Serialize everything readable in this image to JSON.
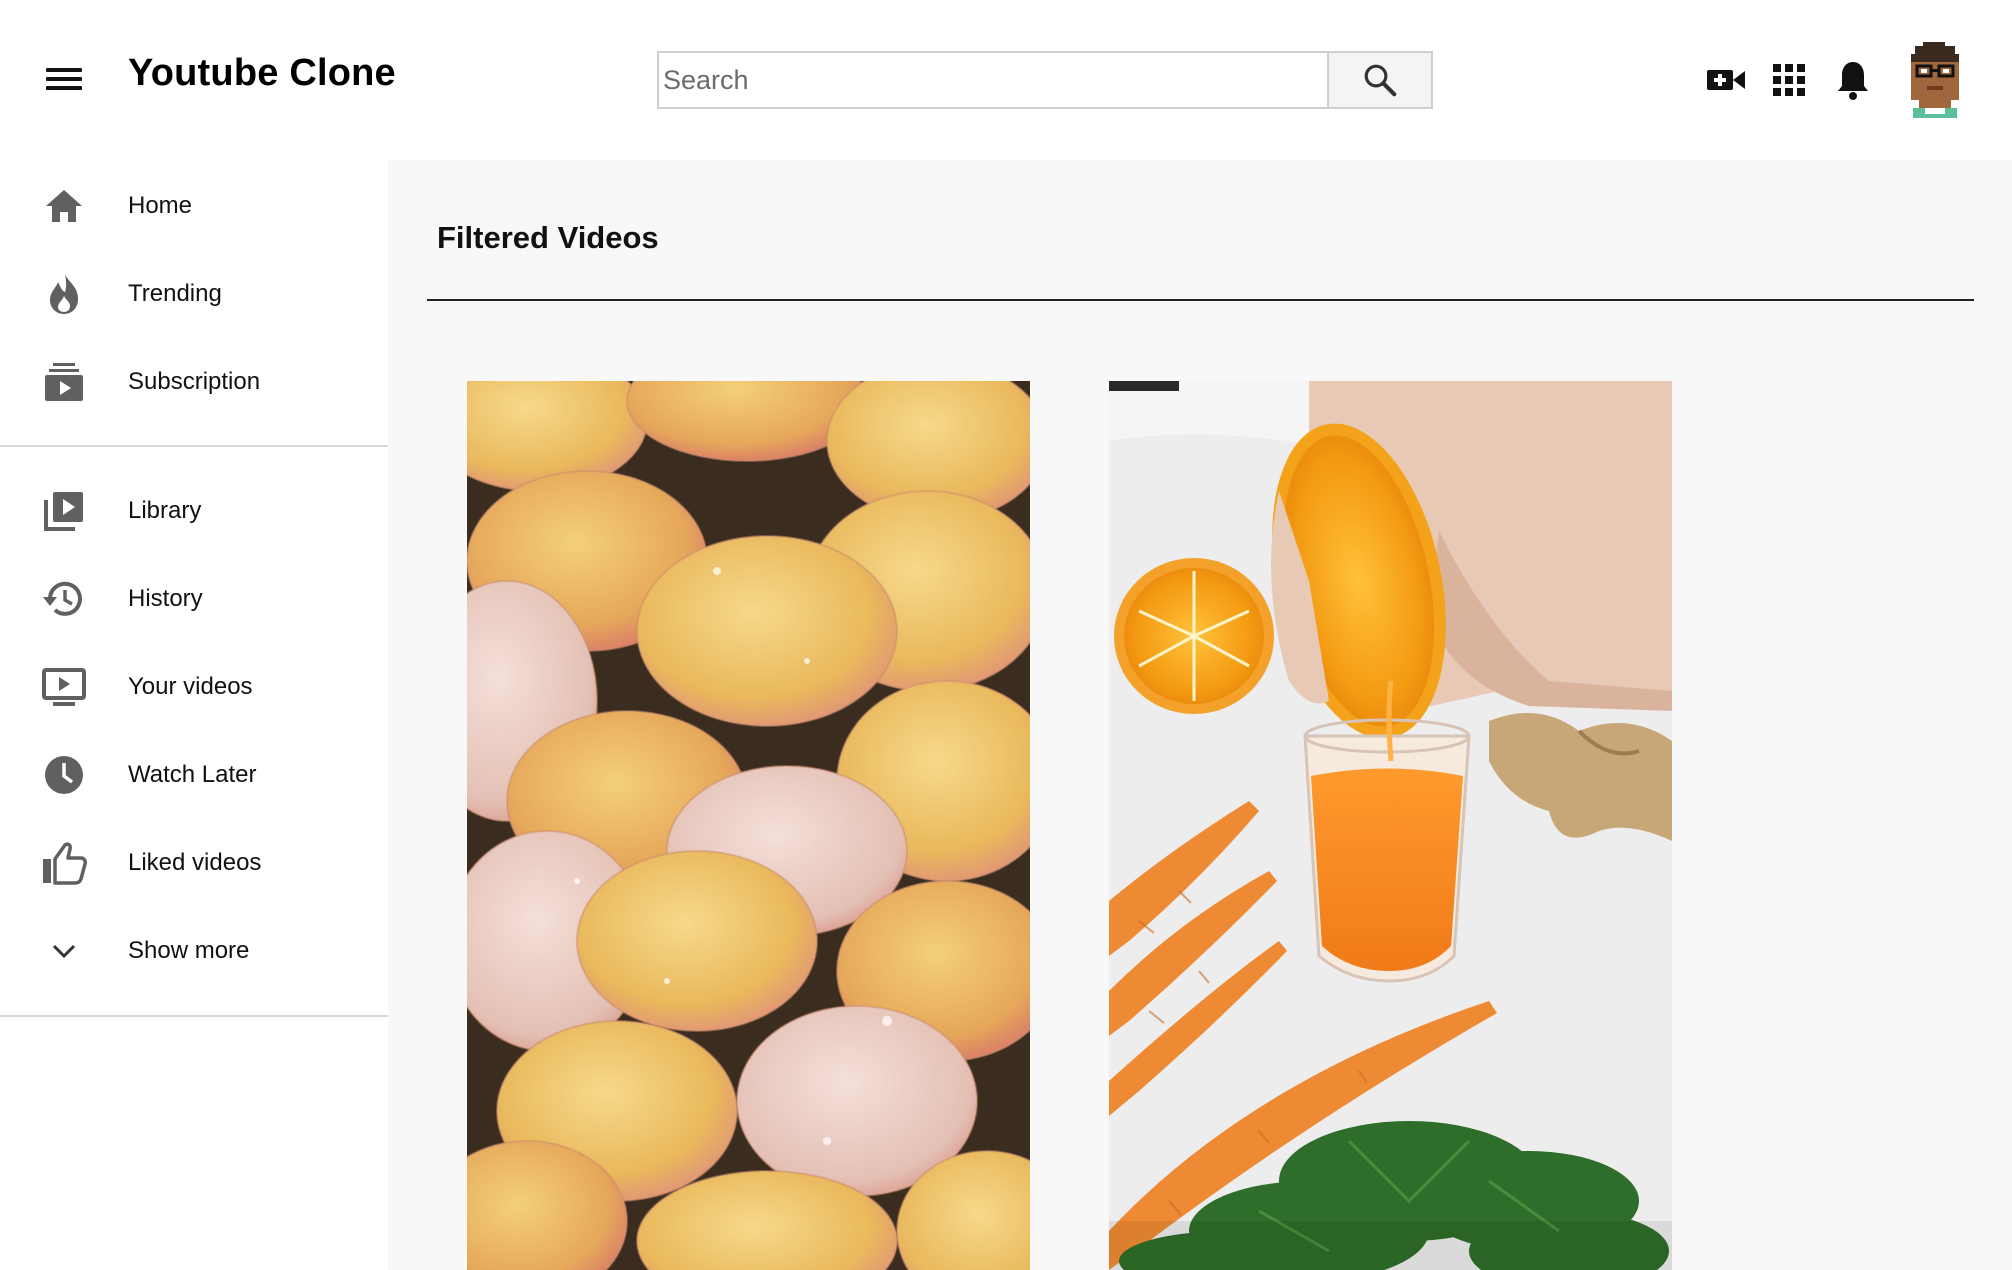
{
  "header": {
    "app_title": "Youtube Clone",
    "menu_icon": "hamburger-menu-icon",
    "search": {
      "placeholder": "Search",
      "value": "",
      "button_icon": "search-icon"
    },
    "actions": [
      {
        "name": "create-video-icon"
      },
      {
        "name": "apps-grid-icon"
      },
      {
        "name": "notifications-bell-icon"
      },
      {
        "name": "avatar"
      }
    ]
  },
  "sidebar": {
    "primary": [
      {
        "label": "Home",
        "icon": "home-icon"
      },
      {
        "label": "Trending",
        "icon": "trending-flame-icon"
      },
      {
        "label": "Subscription",
        "icon": "subscriptions-icon"
      }
    ],
    "secondary": [
      {
        "label": "Library",
        "icon": "library-icon"
      },
      {
        "label": "History",
        "icon": "history-icon"
      },
      {
        "label": "Your videos",
        "icon": "your-videos-icon"
      },
      {
        "label": "Watch Later",
        "icon": "watch-later-clock-icon"
      },
      {
        "label": "Liked videos",
        "icon": "thumbs-up-icon"
      },
      {
        "label": "Show more",
        "icon": "chevron-down-icon"
      }
    ]
  },
  "main": {
    "section_title": "Filtered Videos",
    "videos": [
      {
        "thumbnail": "rose-petals-thumbnail"
      },
      {
        "thumbnail": "orange-carrot-juice-thumbnail"
      }
    ]
  },
  "colors": {
    "main_background": "#f8f8f8",
    "icon_gray": "#606060",
    "divider": "#d8d8d8"
  }
}
